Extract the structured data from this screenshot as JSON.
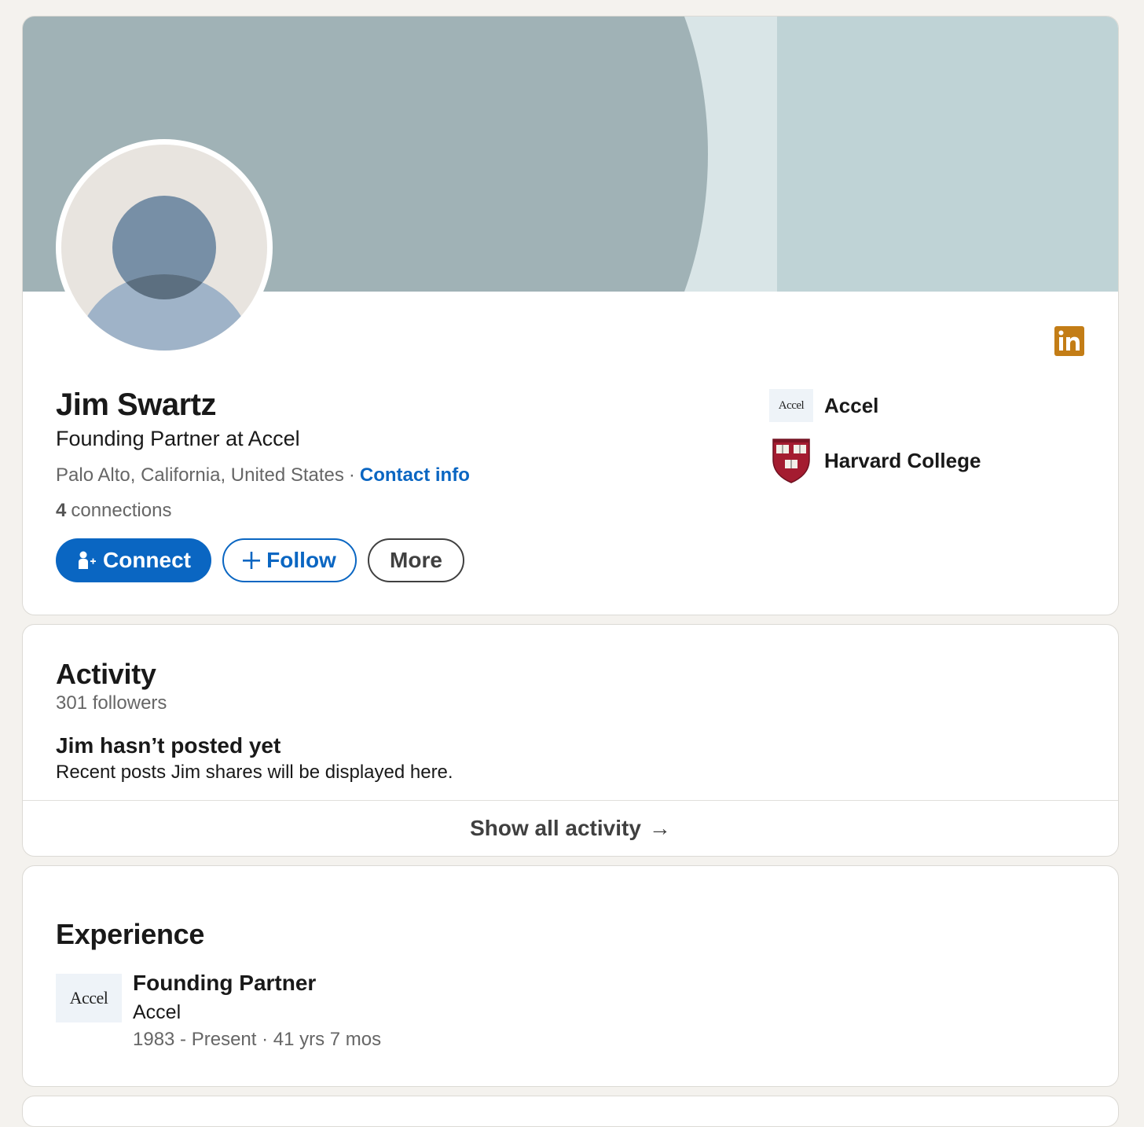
{
  "profile": {
    "name": "Jim Swartz",
    "headline": "Founding Partner at Accel",
    "location": "Palo Alto, California, United States",
    "separator": "·",
    "contact_info_label": "Contact info",
    "connections_count": "4",
    "connections_label": "connections",
    "actions": {
      "connect_label": "Connect",
      "follow_label": "Follow",
      "more_label": "More"
    },
    "side": {
      "company_name": "Accel",
      "company_logo_text": "Accel",
      "school_name": "Harvard College",
      "school_logo_text": "VE RI TAS"
    },
    "badge_icon": "linkedin-icon"
  },
  "activity": {
    "title": "Activity",
    "followers": "301 followers",
    "empty_title": "Jim hasn’t posted yet",
    "empty_description": "Recent posts Jim shares will be displayed here.",
    "show_all_label": "Show all activity",
    "show_all_arrow": "→"
  },
  "experience": {
    "title": "Experience",
    "items": [
      {
        "logo_text": "Accel",
        "role": "Founding Partner",
        "company": "Accel",
        "dates": "1983 - Present · 41 yrs 7 mos"
      }
    ]
  },
  "colors": {
    "accent": "#0a66c2",
    "background": "#f4f2ee",
    "banner_dark": "#a0b2b6",
    "banner_light": "#bfd3d6",
    "linkedin_badge": "#c37d16"
  }
}
